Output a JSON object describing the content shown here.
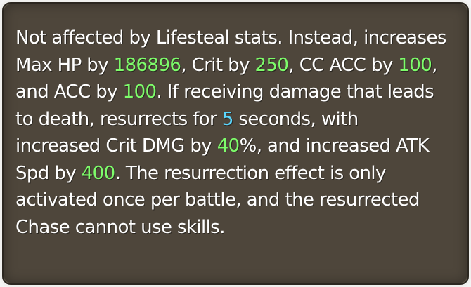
{
  "tooltip": {
    "lines": [
      [
        {
          "text": "Not affected by Lifesteal stats. Instead, increases",
          "color": "white"
        }
      ],
      [
        {
          "text": "Max HP by ",
          "color": "white"
        },
        {
          "text": "186896",
          "color": "green"
        },
        {
          "text": ", Crit by ",
          "color": "white"
        },
        {
          "text": "250",
          "color": "green"
        },
        {
          "text": ", CC ACC by ",
          "color": "white"
        },
        {
          "text": "100",
          "color": "green"
        },
        {
          "text": ",",
          "color": "white"
        }
      ],
      [
        {
          "text": "and ACC by ",
          "color": "white"
        },
        {
          "text": "100",
          "color": "green"
        },
        {
          "text": ". If receiving damage that leads",
          "color": "white"
        }
      ],
      [
        {
          "text": "to death, resurrects for ",
          "color": "white"
        },
        {
          "text": "5",
          "color": "cyan"
        },
        {
          "text": " seconds, with",
          "color": "white"
        }
      ],
      [
        {
          "text": "increased Crit DMG by ",
          "color": "white"
        },
        {
          "text": "40",
          "color": "green"
        },
        {
          "text": "%, and increased ATK",
          "color": "white"
        }
      ],
      [
        {
          "text": "Spd by ",
          "color": "white"
        },
        {
          "text": "400",
          "color": "green"
        },
        {
          "text": ". The resurrection effect is only",
          "color": "white"
        }
      ],
      [
        {
          "text": "activated once per battle, and the resurrected",
          "color": "white"
        }
      ],
      [
        {
          "text": "Chase cannot use skills.",
          "color": "white"
        }
      ]
    ]
  },
  "colors": {
    "panel_background": "#4e463b",
    "panel_border": "#2c2720",
    "text": "#ffffff",
    "highlight_green": "#7dfc6a",
    "highlight_cyan": "#5ad7ff"
  }
}
